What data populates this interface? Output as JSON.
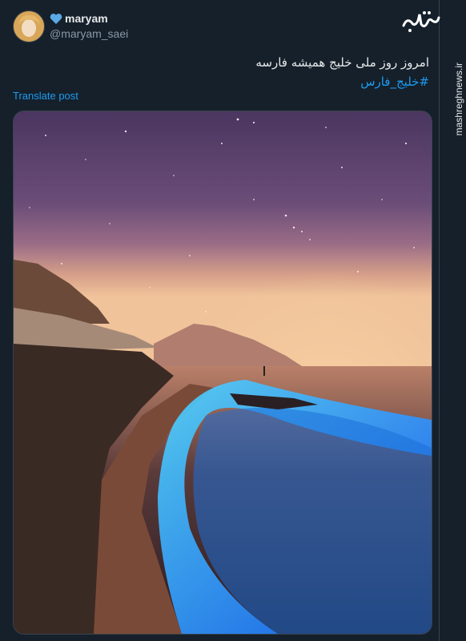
{
  "post": {
    "display_name": "maryam",
    "handle": "@maryam_saei",
    "text": "امروز روز ملی خلیج همیشه فارسه",
    "hashtag": "#خلیج_فارس",
    "translate_label": "Translate post"
  },
  "watermark": {
    "site": "mashreghnews.ir",
    "logo_icon": "mashregh-logo-icon"
  },
  "colors": {
    "background": "#15202b",
    "accent": "#1d9bf0",
    "heart": "#5aa9e6",
    "secondary_text": "#8b98a5"
  },
  "media": {
    "description_icon": "night-beach-photo"
  }
}
